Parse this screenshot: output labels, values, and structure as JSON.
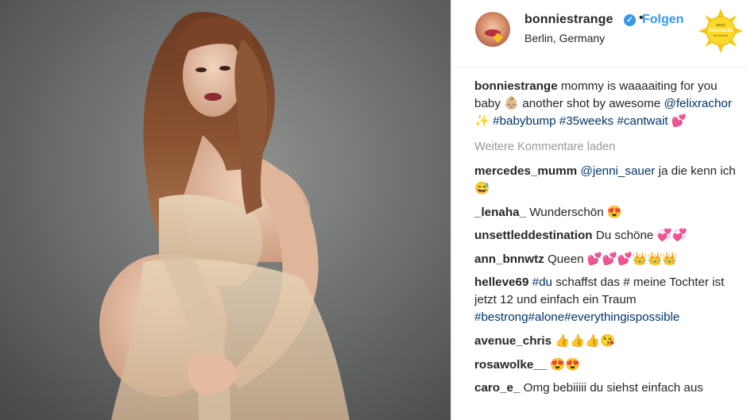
{
  "post": {
    "username": "bonniestrange",
    "follow_label": "Folgen",
    "location": "Berlin, Germany",
    "caption": {
      "user": "bonniestrange",
      "p1": "mommy is waaaaiting for you baby 👶🏼 another shot by awesome ",
      "m1": "@felixrachor",
      "p2": " ✨ ",
      "h1": "#babybump",
      "p3": " ",
      "h2": "#35weeks",
      "p4": " ",
      "h3": "#cantwait",
      "p5": " 💕"
    },
    "load_more": "Weitere Kommentare laden"
  },
  "comments": [
    {
      "user": "mercedes_mumm",
      "mention": "@jenni_sauer",
      "text": " ja die kenn ich 😅"
    },
    {
      "user": "_lenaha_",
      "text": "Wunderschön 😍"
    },
    {
      "user": "unsettleddestination",
      "text": "Du schöne 💞💞"
    },
    {
      "user": "ann_bnnwtz",
      "text": "Queen 💕💕💕👑👑👑"
    },
    {
      "user": "helleve69",
      "tag1": "#du",
      "text1": " schaffst das # meine Tochter ist jetzt 12 und einfach ein Traum ",
      "tag2": "#bestrong#alone#everythingispossible"
    },
    {
      "user": "avenue_chris",
      "text": "👍👍👍😘"
    },
    {
      "user": "rosawolke__",
      "text": "😍😍"
    },
    {
      "user": "caro_e_",
      "text": "Omg bebiiiii du siehst einfach aus"
    }
  ],
  "logo": {
    "top": "SAT.1",
    "mid": "frühstücks",
    "bot": "fernsehen"
  },
  "colors": {
    "accent": "#3897f0",
    "hashtag": "#003569",
    "muted": "#999999"
  },
  "icons": [
    "verified-badge-icon",
    "sun-logo-icon"
  ]
}
